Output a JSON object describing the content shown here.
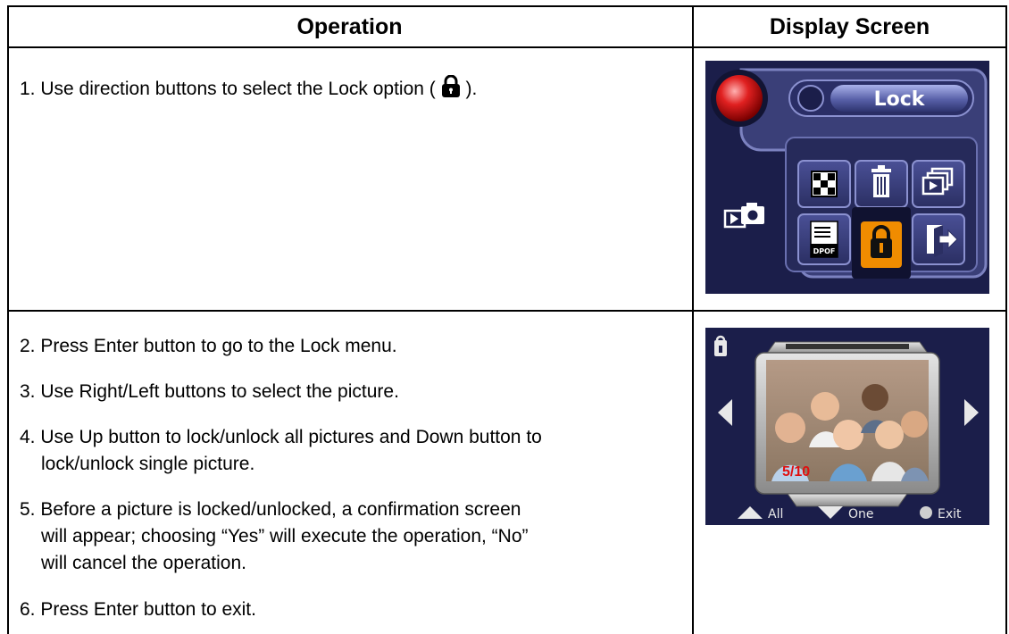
{
  "header": {
    "operation": "Operation",
    "display_screen": "Display Screen"
  },
  "row1": {
    "step1_before": "1. Use direction buttons to select the Lock option (",
    "step1_after": ").",
    "menu": {
      "title": "Lock",
      "icons": [
        "thumbnail-icon",
        "trash-icon",
        "slideshow-icon",
        "dpof-icon",
        "lock-icon",
        "exit-icon"
      ],
      "dpof_label": "DPOF",
      "selected": "lock-icon"
    }
  },
  "row2": {
    "steps": [
      {
        "line1": "2. Press Enter button to go to the Lock menu.",
        "line2": ""
      },
      {
        "line1": "3. Use Right/Left buttons to select the picture.",
        "line2": ""
      },
      {
        "line1": "4. Use Up button to lock/unlock all pictures and Down button to",
        "line2": "lock/unlock single picture."
      },
      {
        "line1": "5. Before a picture is locked/unlocked, a confirmation screen",
        "line2": "will appear; choosing “Yes” will execute the operation, “No”",
        "line3": "will cancel the operation."
      },
      {
        "line1": "6. Press Enter button to exit.",
        "line2": ""
      }
    ],
    "screen": {
      "counter": "5/10",
      "all_label": "All",
      "one_label": "One",
      "exit_label": "Exit"
    }
  },
  "colors": {
    "menu_bg": "#1b1e4a",
    "menu_panel": "#3a3f78",
    "selected_tile": "#f08c00",
    "counter_red": "#e01010"
  }
}
